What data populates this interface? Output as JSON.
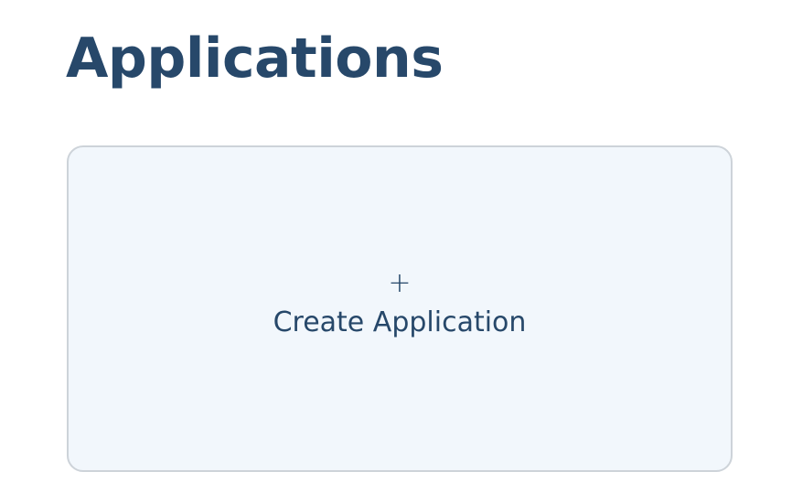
{
  "header": {
    "title": "Applications"
  },
  "create_card": {
    "icon": "+",
    "icon_name": "plus-icon",
    "label": "Create Application"
  },
  "colors": {
    "title": "#27486a",
    "card_background": "#f2f7fc",
    "card_border": "#cdd3d9",
    "card_text": "#27486a"
  }
}
